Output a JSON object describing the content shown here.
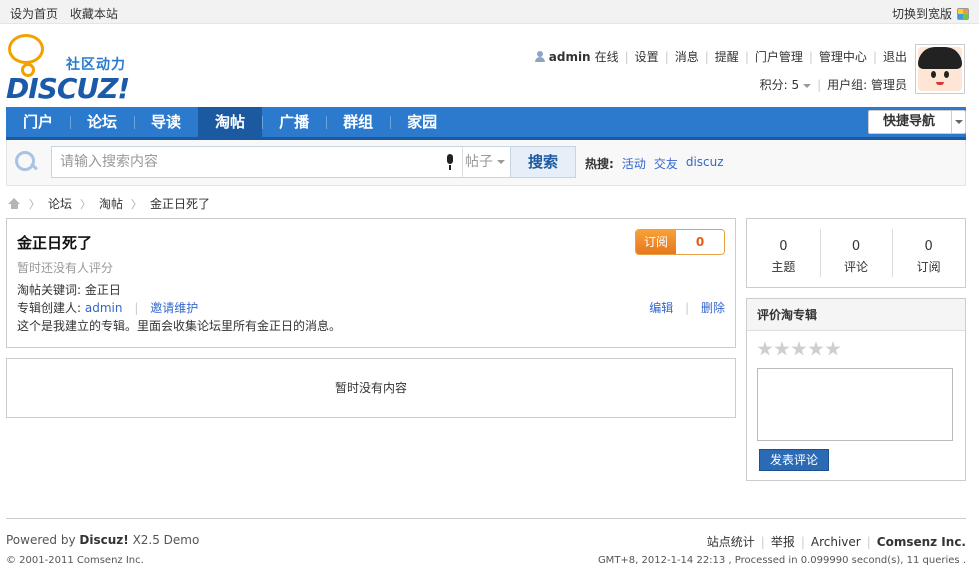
{
  "topbar": {
    "set_home": "设为首页",
    "bookmark": "收藏本站",
    "switch_wide": "切换到宽版"
  },
  "logo": {
    "slogan": "社区动力",
    "word": "DISCUZ!"
  },
  "usermenu": {
    "username": "admin",
    "online": "在线",
    "items": [
      "设置",
      "消息",
      "提醒",
      "门户管理",
      "管理中心",
      "退出"
    ]
  },
  "userinfo": {
    "points": "积分: 5",
    "usergroup": "用户组: 管理员"
  },
  "nav": {
    "items": [
      "门户",
      "论坛",
      "导读",
      "淘帖",
      "广播",
      "群组",
      "家园"
    ],
    "active_index": 3,
    "quick_nav": "快捷导航"
  },
  "search": {
    "placeholder": "请输入搜索内容",
    "type": "帖子",
    "button": "搜索",
    "hot_label": "热搜:",
    "hot_items": [
      "活动",
      "交友",
      "discuz"
    ]
  },
  "breadcrumb": [
    "论坛",
    "淘帖",
    "金正日死了"
  ],
  "album": {
    "title": "金正日死了",
    "rating_text": "暂时还没有人评分",
    "keywords": "淘帖关键词: 金正日",
    "creator_label": "专辑创建人:",
    "creator": "admin",
    "invite": "邀请维护",
    "description": "这个是我建立的专辑。里面会收集论坛里所有金正日的消息。",
    "edit": "编辑",
    "delete": "删除",
    "subscribe_label": "订阅",
    "subscribe_count": "0"
  },
  "empty_text": "暂时没有内容",
  "stats": [
    {
      "value": "0",
      "label": "主题"
    },
    {
      "value": "0",
      "label": "评论"
    },
    {
      "value": "0",
      "label": "订阅"
    }
  ],
  "review": {
    "title": "评价淘专辑",
    "submit": "发表评论"
  },
  "footer": {
    "powered": "Powered by",
    "brand": "Discuz!",
    "version": "X2.5 Demo",
    "copyright": "© 2001-2011 Comsenz Inc.",
    "links": [
      "站点统计",
      "举报",
      "Archiver"
    ],
    "company": "Comsenz Inc.",
    "gmt": "GMT+8, 2012-1-14 22:13 , Processed in 0.099990 second(s), 11 queries ."
  }
}
